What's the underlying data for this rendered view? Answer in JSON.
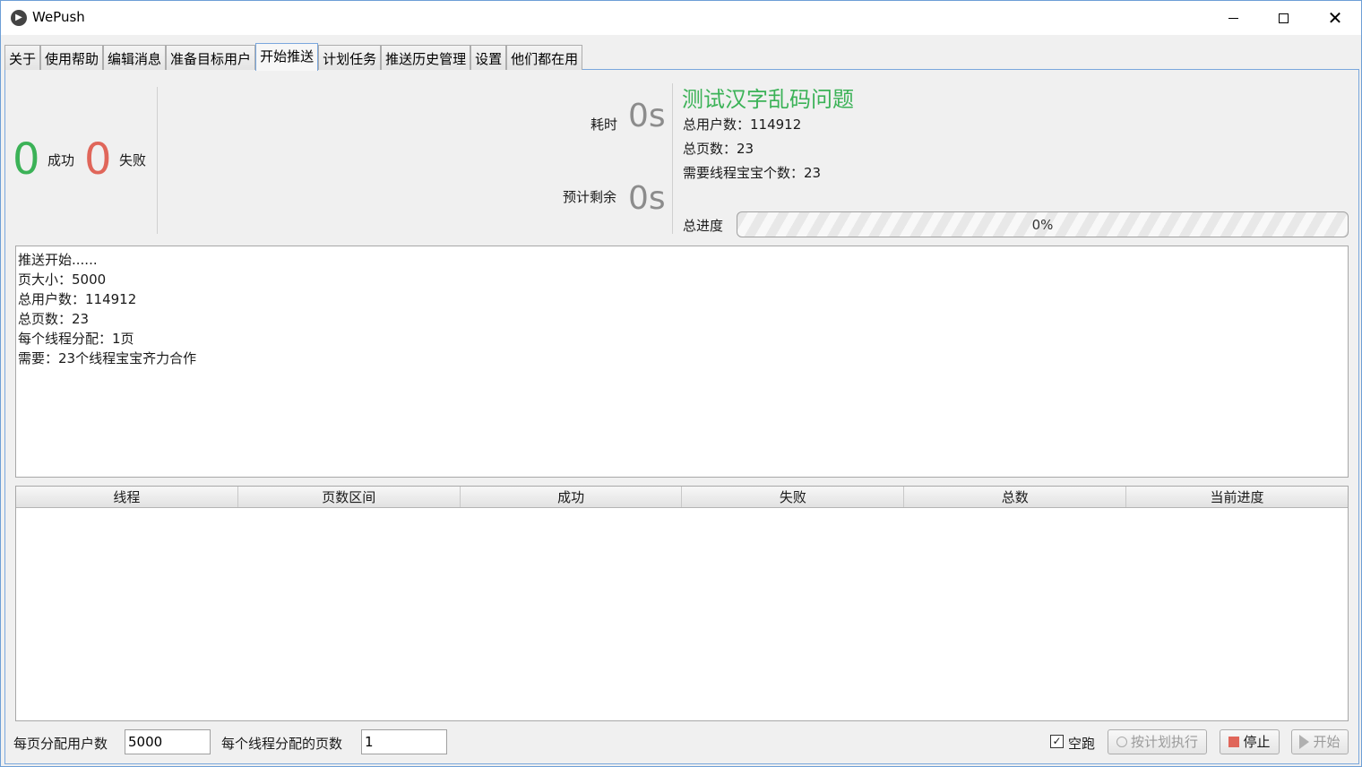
{
  "window": {
    "title": "WePush"
  },
  "tabs": [
    {
      "label": "关于"
    },
    {
      "label": "使用帮助"
    },
    {
      "label": "编辑消息"
    },
    {
      "label": "准备目标用户"
    },
    {
      "label": "开始推送",
      "active": true
    },
    {
      "label": "计划任务"
    },
    {
      "label": "推送历史管理"
    },
    {
      "label": "设置"
    },
    {
      "label": "他们都在用"
    }
  ],
  "stats": {
    "success_count": "0",
    "success_label": "成功",
    "fail_count": "0",
    "fail_label": "失败",
    "elapsed_label": "耗时",
    "elapsed_value": "0s",
    "remaining_label": "预计剩余",
    "remaining_value": "0s"
  },
  "info": {
    "title": "测试汉字乱码问题",
    "total_users": "总用户数：114912",
    "total_pages": "总页数：23",
    "threads_needed": "需要线程宝宝个数：23"
  },
  "progress": {
    "label": "总进度",
    "text": "0%",
    "fraction": 0
  },
  "log": {
    "lines": [
      "推送开始......",
      "页大小：5000",
      "总用户数：114912",
      "总页数：23",
      "每个线程分配：1页",
      "需要：23个线程宝宝齐力合作"
    ]
  },
  "table": {
    "headers": [
      "线程",
      "页数区间",
      "成功",
      "失败",
      "总数",
      "当前进度"
    ],
    "rows": []
  },
  "bottom": {
    "page_size_label": "每页分配用户数",
    "page_size_value": "5000",
    "pages_per_thread_label": "每个线程分配的页数",
    "pages_per_thread_value": "1",
    "dry_run_label": "空跑",
    "dry_run_checked": true,
    "schedule_button": "按计划执行",
    "stop_button": "停止",
    "start_button": "开始"
  },
  "colors": {
    "success": "#3bb257",
    "fail": "#e0665a",
    "accent_border": "#7aa7dd"
  }
}
